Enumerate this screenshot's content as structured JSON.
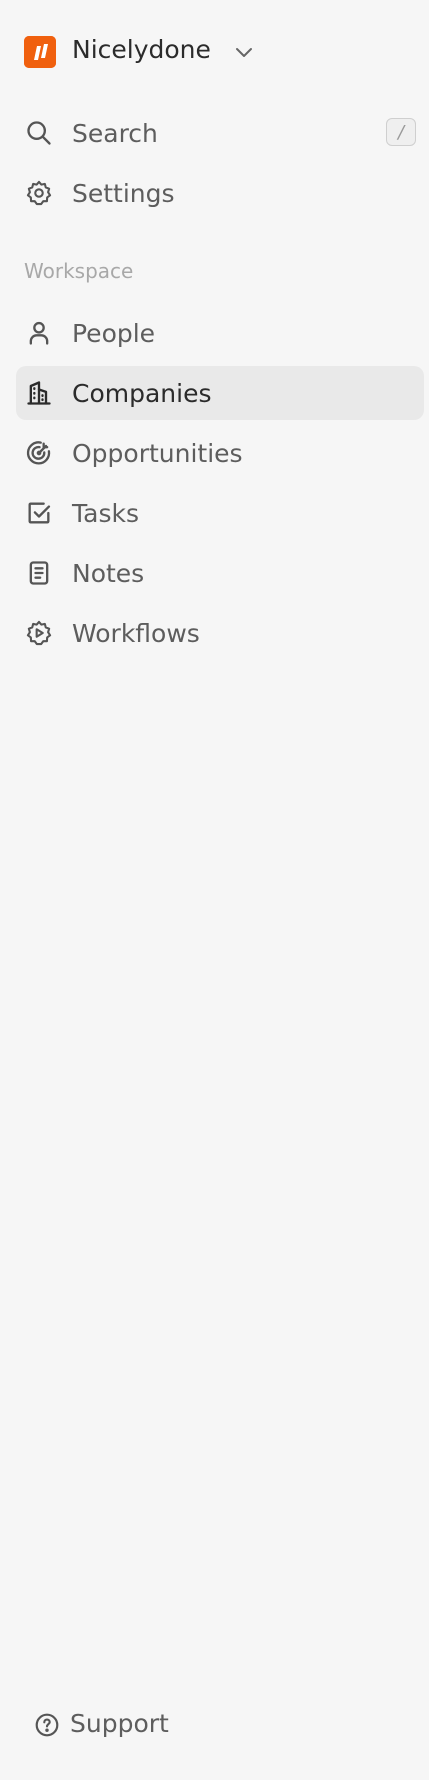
{
  "workspace": {
    "name": "Nicelydone",
    "logo_color": "#f0600e"
  },
  "top_nav": [
    {
      "label": "Search",
      "icon": "search-icon",
      "shortcut": "/"
    },
    {
      "label": "Settings",
      "icon": "gear-icon"
    }
  ],
  "section": {
    "label": "Workspace"
  },
  "workspace_nav": [
    {
      "label": "People",
      "icon": "person-icon",
      "active": false
    },
    {
      "label": "Companies",
      "icon": "building-icon",
      "active": true
    },
    {
      "label": "Opportunities",
      "icon": "target-icon",
      "active": false
    },
    {
      "label": "Tasks",
      "icon": "checkbox-icon",
      "active": false
    },
    {
      "label": "Notes",
      "icon": "note-icon",
      "active": false
    },
    {
      "label": "Workflows",
      "icon": "workflow-gear-play-icon",
      "active": false
    }
  ],
  "footer": {
    "support_label": "Support",
    "support_icon": "help-circle-icon"
  },
  "colors": {
    "background": "#f6f6f6",
    "active_row": "#e9e9e9",
    "accent": "#f0600e"
  }
}
